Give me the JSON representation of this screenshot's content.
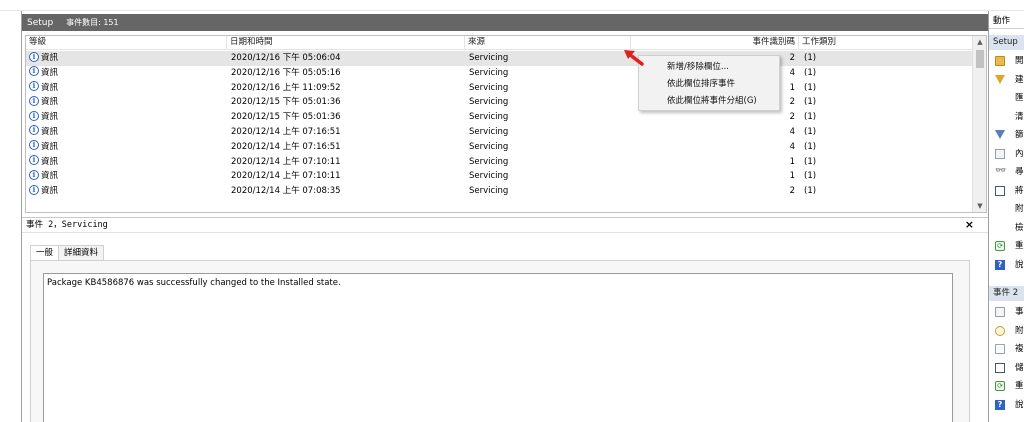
{
  "log": {
    "name": "Setup",
    "event_count": "事件數目: 151"
  },
  "columns": [
    "等級",
    "日期和時間",
    "來源",
    "事件識別碼",
    "工作類別"
  ],
  "rows": [
    {
      "level": "資訊",
      "datetime": "2020/12/16 下午 05:06:04",
      "source": "Servicing",
      "event_id": "2",
      "task": "(1)",
      "selected": true
    },
    {
      "level": "資訊",
      "datetime": "2020/12/16 下午 05:05:16",
      "source": "Servicing",
      "event_id": "4",
      "task": "(1)"
    },
    {
      "level": "資訊",
      "datetime": "2020/12/16 上午 11:09:52",
      "source": "Servicing",
      "event_id": "1",
      "task": "(1)"
    },
    {
      "level": "資訊",
      "datetime": "2020/12/15 下午 05:01:36",
      "source": "Servicing",
      "event_id": "2",
      "task": "(1)"
    },
    {
      "level": "資訊",
      "datetime": "2020/12/15 下午 05:01:36",
      "source": "Servicing",
      "event_id": "2",
      "task": "(1)"
    },
    {
      "level": "資訊",
      "datetime": "2020/12/14 上午 07:16:51",
      "source": "Servicing",
      "event_id": "4",
      "task": "(1)"
    },
    {
      "level": "資訊",
      "datetime": "2020/12/14 上午 07:16:51",
      "source": "Servicing",
      "event_id": "4",
      "task": "(1)"
    },
    {
      "level": "資訊",
      "datetime": "2020/12/14 上午 07:10:11",
      "source": "Servicing",
      "event_id": "1",
      "task": "(1)"
    },
    {
      "level": "資訊",
      "datetime": "2020/12/14 上午 07:10:11",
      "source": "Servicing",
      "event_id": "1",
      "task": "(1)"
    },
    {
      "level": "資訊",
      "datetime": "2020/12/14 上午 07:08:35",
      "source": "Servicing",
      "event_id": "2",
      "task": "(1)"
    }
  ],
  "context_menu": [
    "新增/移除欄位...",
    "依此欄位排序事件",
    "依此欄位將事件分組(G)"
  ],
  "detail": {
    "title": "事件 2，Servicing",
    "tabs": [
      "一般",
      "詳細資料"
    ],
    "description": "Package KB4586876 was successfully changed to the Installed state."
  },
  "actions": {
    "header": "動作",
    "section1": "Setup",
    "section1_items": [
      {
        "icon": "folder-open-icon",
        "label": "開"
      },
      {
        "icon": "filter-icon",
        "label": "建"
      },
      {
        "icon": "",
        "label": "匯"
      },
      {
        "icon": "",
        "label": "清"
      },
      {
        "icon": "filter-current-icon",
        "label": "篩"
      },
      {
        "icon": "properties-icon",
        "label": "內"
      },
      {
        "icon": "find-icon",
        "label": "尋"
      },
      {
        "icon": "save-icon",
        "label": "將"
      },
      {
        "icon": "",
        "label": "附"
      },
      {
        "icon": "",
        "label": "檢"
      },
      {
        "icon": "refresh-icon",
        "label": "重"
      },
      {
        "icon": "help-icon",
        "label": "說"
      }
    ],
    "section2": "事件 2",
    "section2_items": [
      {
        "icon": "event-properties-icon",
        "label": "事"
      },
      {
        "icon": "attach-task-icon",
        "label": "附"
      },
      {
        "icon": "copy-icon",
        "label": "複"
      },
      {
        "icon": "save-icon",
        "label": "儲"
      },
      {
        "icon": "refresh-icon",
        "label": "重"
      },
      {
        "icon": "help-icon",
        "label": "說"
      }
    ]
  }
}
